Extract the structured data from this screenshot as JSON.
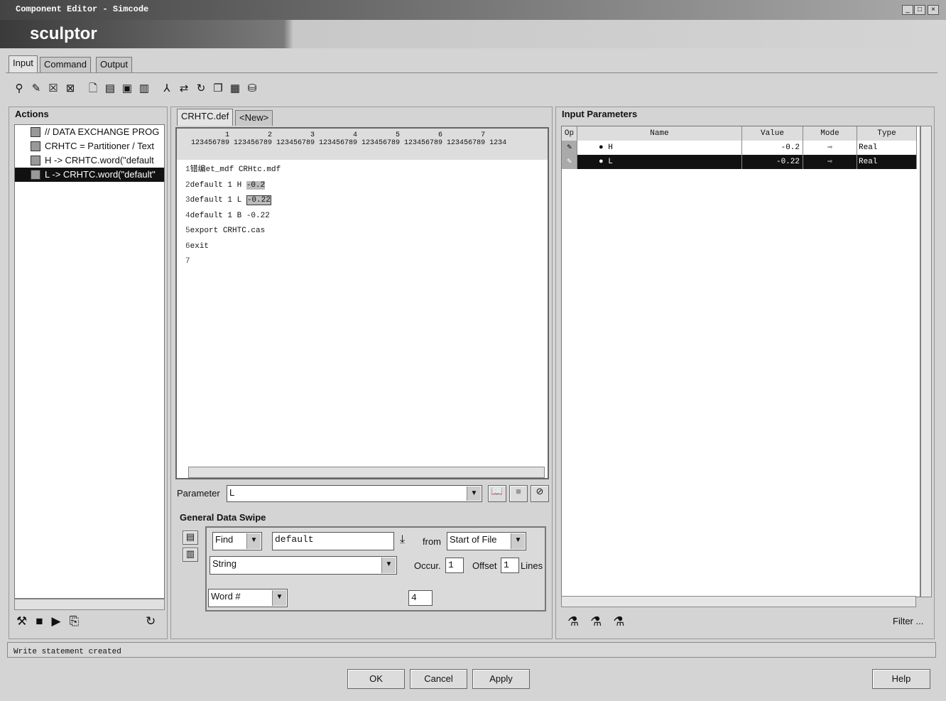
{
  "window": {
    "title": "Component Editor - Simcode",
    "min": "_",
    "max": "□",
    "close": "×"
  },
  "banner": {
    "app": "sculptor"
  },
  "tabs": [
    {
      "label": "Input"
    },
    {
      "label": "Command"
    },
    {
      "label": "Output"
    }
  ],
  "actions": {
    "title": "Actions",
    "items": [
      {
        "label": "// DATA EXCHANGE PROG"
      },
      {
        "label": "CRHTC = Partitioner / Text"
      },
      {
        "label": "H -> CRHTC.word(\"default"
      },
      {
        "label": "L -> CRHTC.word(\"default\""
      }
    ]
  },
  "editor": {
    "tabs": [
      {
        "label": "CRHTC.def"
      },
      {
        "label": "<New>"
      }
    ],
    "ruler_tens": "        1         2         3         4         5         6         7",
    "ruler_units": "123456789 123456789 123456789 123456789 123456789 123456789 123456789 1234",
    "lines": [
      {
        "n": "1",
        "text": "错编et_mdf CRHtc.mdf"
      },
      {
        "n": "2",
        "text": "default 1 H ",
        "hl": "-0.2"
      },
      {
        "n": "3",
        "text": "default 1 L ",
        "hl": "-0.22"
      },
      {
        "n": "4",
        "text": "default 1 B -0.22"
      },
      {
        "n": "5",
        "text": "export CRHTC.cas"
      },
      {
        "n": "6",
        "text": "exit"
      },
      {
        "n": "7",
        "text": ""
      }
    ]
  },
  "parameter": {
    "label": "Parameter",
    "value": "L"
  },
  "swipe": {
    "title": "General Data Swipe",
    "find": "Find",
    "find_value": "default",
    "from_label": "from",
    "from_value": "Start of File",
    "type": "String",
    "occur_label": "Occur.",
    "occur": "1",
    "offset_label": "Offset",
    "offset": "1",
    "lines_label": "Lines",
    "word": "Word #",
    "word_value": "4"
  },
  "params": {
    "title": "Input Parameters",
    "columns": [
      "Op",
      "Name",
      "Value",
      "Mode",
      "Type"
    ],
    "rows": [
      {
        "name": "H",
        "value": "-0.2",
        "type": "Real"
      },
      {
        "name": "L",
        "value": "-0.22",
        "type": "Real",
        "selected": true
      }
    ],
    "filter": "Filter ..."
  },
  "status": "Write statement created",
  "buttons": {
    "ok": "OK",
    "cancel": "Cancel",
    "apply": "Apply",
    "help": "Help"
  }
}
